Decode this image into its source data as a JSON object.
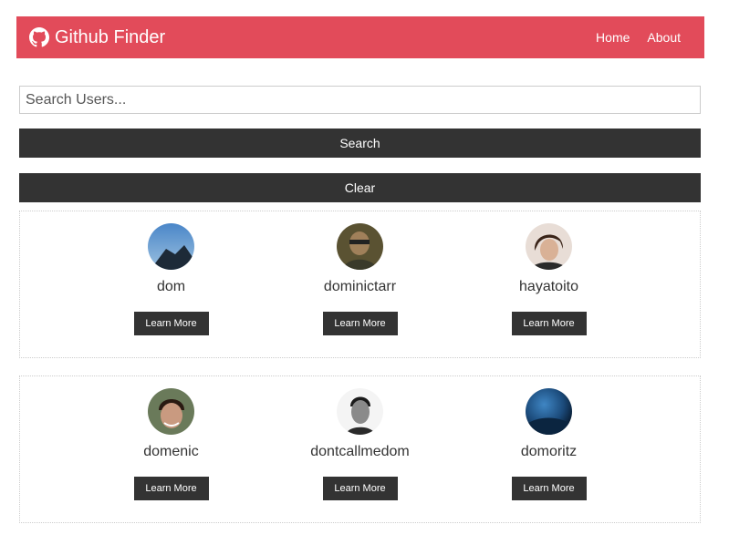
{
  "navbar": {
    "brand": "Github Finder",
    "brand_icon": "github-icon",
    "links": [
      {
        "label": "Home"
      },
      {
        "label": "About"
      }
    ],
    "bg_color": "#e24b5a"
  },
  "search": {
    "placeholder": "Search Users...",
    "value": "",
    "search_button": "Search",
    "clear_button": "Clear"
  },
  "users": [
    {
      "login": "dom",
      "button": "Learn More"
    },
    {
      "login": "dominictarr",
      "button": "Learn More"
    },
    {
      "login": "hayatoito",
      "button": "Learn More"
    },
    {
      "login": "domenic",
      "button": "Learn More"
    },
    {
      "login": "dontcallmedom",
      "button": "Learn More"
    },
    {
      "login": "domoritz",
      "button": "Learn More"
    }
  ]
}
